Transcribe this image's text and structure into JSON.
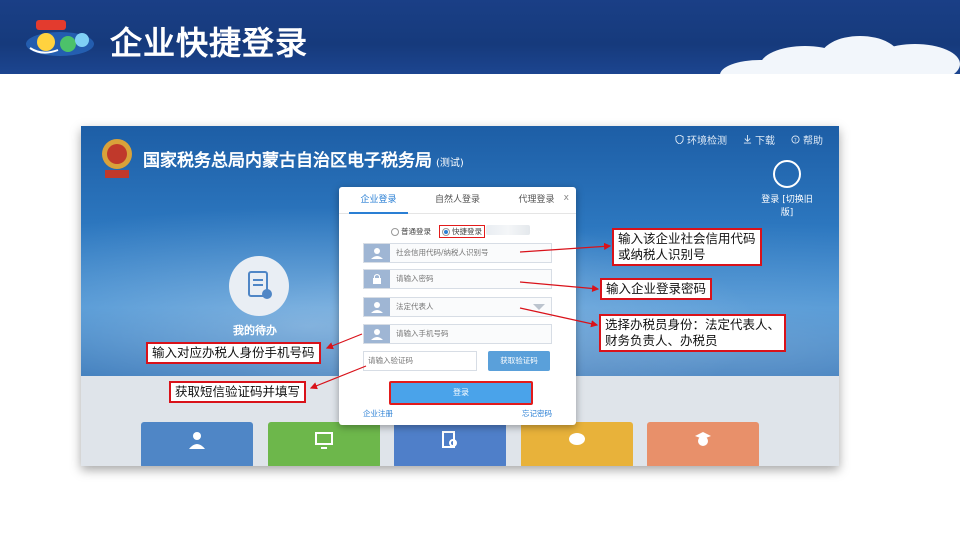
{
  "slide": {
    "title": "企业快捷登录",
    "logo_icon": "tax-mascot-logo"
  },
  "site": {
    "title": "国家税务总局内蒙古自治区电子税务局",
    "title_suffix": "(测试)",
    "emblem_icon": "tax-emblem-icon",
    "toplinks": [
      {
        "label": "环境检测",
        "icon": "shield-icon"
      },
      {
        "label": "下载",
        "icon": "download-icon"
      },
      {
        "label": "帮助",
        "icon": "help-icon"
      }
    ],
    "login_label": "登录",
    "login_sub": "[切换旧版]",
    "todo_label": "我的待办"
  },
  "modal": {
    "tabs": [
      "企业登录",
      "自然人登录",
      "代理登录"
    ],
    "active_tab": 0,
    "close": "x",
    "modes": [
      "普通登录",
      "快捷登录"
    ],
    "selected_mode": 1,
    "fields": {
      "credit_code": "社会信用代码/纳税人识别号",
      "password": "请输入密码",
      "role": "法定代表人",
      "phone": "请输入手机号码",
      "captcha": "请输入验证码"
    },
    "sms_button": "获取验证码",
    "login_button": "登录",
    "register_link": "企业注册",
    "forgot_link": "忘记密码"
  },
  "callouts": {
    "credit": "输入该企业社会信用代码\n或纳税人识别号",
    "password": "输入企业登录密码",
    "role": "选择办税员身份：法定代表人、\n财务负责人、办税员",
    "phone": "输入对应办税人身份手机号码",
    "sms": "获取短信验证码并填写"
  },
  "colors": {
    "header": "#173c80",
    "accent": "#2a7fd4",
    "annotation": "#d9121a"
  }
}
